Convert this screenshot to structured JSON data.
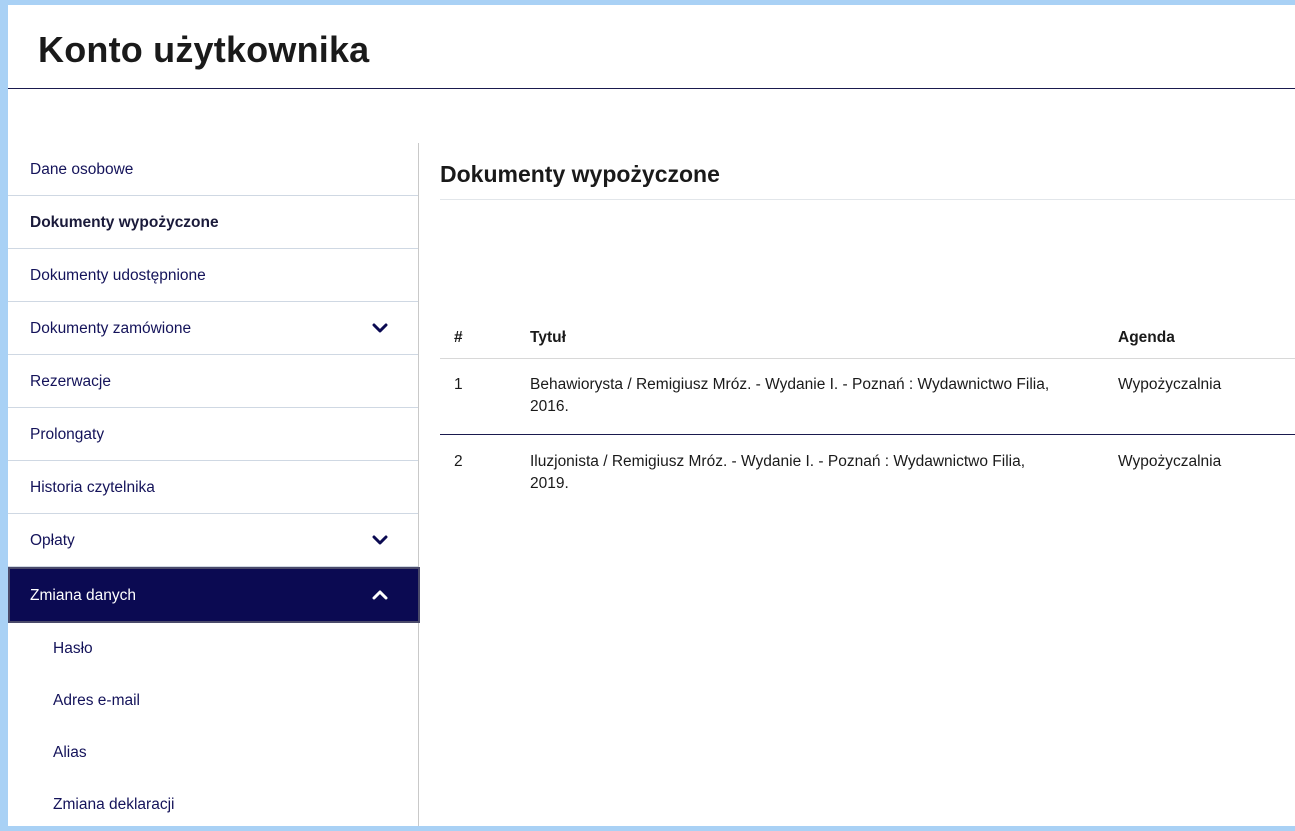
{
  "header": {
    "title": "Konto użytkownika"
  },
  "sidebar": {
    "items": [
      {
        "label": "Dane osobowe",
        "bold": false,
        "chevron": "none"
      },
      {
        "label": "Dokumenty wypożyczone",
        "bold": true,
        "chevron": "none"
      },
      {
        "label": "Dokumenty udostępnione",
        "bold": false,
        "chevron": "none"
      },
      {
        "label": "Dokumenty zamówione",
        "bold": false,
        "chevron": "down"
      },
      {
        "label": "Rezerwacje",
        "bold": false,
        "chevron": "none"
      },
      {
        "label": "Prolongaty",
        "bold": false,
        "chevron": "none"
      },
      {
        "label": "Historia czytelnika",
        "bold": false,
        "chevron": "none"
      },
      {
        "label": "Opłaty",
        "bold": false,
        "chevron": "down"
      },
      {
        "label": "Zmiana danych",
        "bold": false,
        "chevron": "up",
        "expanded": true
      }
    ],
    "sub_items": [
      {
        "label": "Hasło"
      },
      {
        "label": "Adres e-mail"
      },
      {
        "label": "Alias"
      },
      {
        "label": "Zmiana deklaracji"
      }
    ]
  },
  "main": {
    "section_title": "Dokumenty wypożyczone",
    "table": {
      "headers": {
        "num": "#",
        "title": "Tytuł",
        "agenda": "Agenda"
      },
      "rows": [
        {
          "num": "1",
          "title": "Behawiorysta / Remigiusz Mróz. - Wydanie I. - Poznań : Wydawnictwo Filia, 2016.",
          "agenda": "Wypożyczalnia"
        },
        {
          "num": "2",
          "title": "Iluzjonista / Remigiusz Mróz. - Wydanie I. - Poznań : Wydawnictwo Filia, 2019.",
          "agenda": "Wypożyczalnia"
        }
      ]
    }
  },
  "colors": {
    "outer_background": "#a9d1f5",
    "nav_text": "#14135a",
    "active_background": "#0b0a52"
  },
  "icons": {
    "chevron_down": "chevron-down-icon",
    "chevron_up": "chevron-up-icon"
  }
}
